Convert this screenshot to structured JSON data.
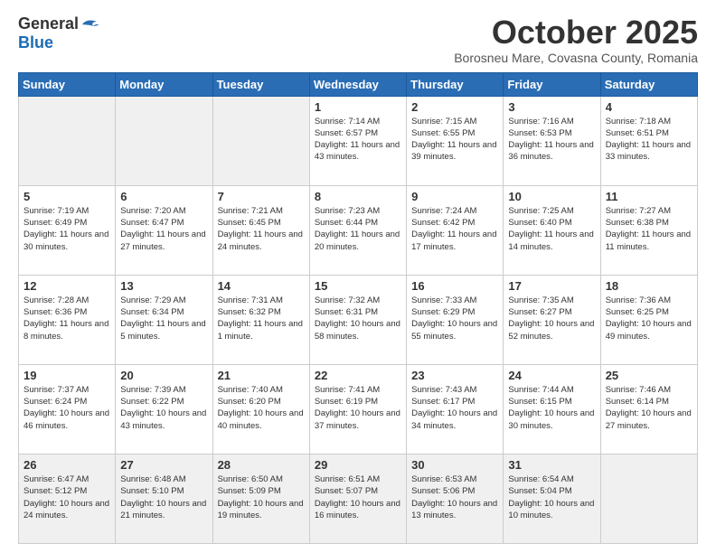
{
  "logo": {
    "general": "General",
    "blue": "Blue"
  },
  "title": "October 2025",
  "subtitle": "Borosneu Mare, Covasna County, Romania",
  "days_of_week": [
    "Sunday",
    "Monday",
    "Tuesday",
    "Wednesday",
    "Thursday",
    "Friday",
    "Saturday"
  ],
  "weeks": [
    [
      {
        "day": "",
        "info": "",
        "empty": true
      },
      {
        "day": "",
        "info": "",
        "empty": true
      },
      {
        "day": "",
        "info": "",
        "empty": true
      },
      {
        "day": "1",
        "info": "Sunrise: 7:14 AM\nSunset: 6:57 PM\nDaylight: 11 hours and 43 minutes."
      },
      {
        "day": "2",
        "info": "Sunrise: 7:15 AM\nSunset: 6:55 PM\nDaylight: 11 hours and 39 minutes."
      },
      {
        "day": "3",
        "info": "Sunrise: 7:16 AM\nSunset: 6:53 PM\nDaylight: 11 hours and 36 minutes."
      },
      {
        "day": "4",
        "info": "Sunrise: 7:18 AM\nSunset: 6:51 PM\nDaylight: 11 hours and 33 minutes."
      }
    ],
    [
      {
        "day": "5",
        "info": "Sunrise: 7:19 AM\nSunset: 6:49 PM\nDaylight: 11 hours and 30 minutes."
      },
      {
        "day": "6",
        "info": "Sunrise: 7:20 AM\nSunset: 6:47 PM\nDaylight: 11 hours and 27 minutes."
      },
      {
        "day": "7",
        "info": "Sunrise: 7:21 AM\nSunset: 6:45 PM\nDaylight: 11 hours and 24 minutes."
      },
      {
        "day": "8",
        "info": "Sunrise: 7:23 AM\nSunset: 6:44 PM\nDaylight: 11 hours and 20 minutes."
      },
      {
        "day": "9",
        "info": "Sunrise: 7:24 AM\nSunset: 6:42 PM\nDaylight: 11 hours and 17 minutes."
      },
      {
        "day": "10",
        "info": "Sunrise: 7:25 AM\nSunset: 6:40 PM\nDaylight: 11 hours and 14 minutes."
      },
      {
        "day": "11",
        "info": "Sunrise: 7:27 AM\nSunset: 6:38 PM\nDaylight: 11 hours and 11 minutes."
      }
    ],
    [
      {
        "day": "12",
        "info": "Sunrise: 7:28 AM\nSunset: 6:36 PM\nDaylight: 11 hours and 8 minutes."
      },
      {
        "day": "13",
        "info": "Sunrise: 7:29 AM\nSunset: 6:34 PM\nDaylight: 11 hours and 5 minutes."
      },
      {
        "day": "14",
        "info": "Sunrise: 7:31 AM\nSunset: 6:32 PM\nDaylight: 11 hours and 1 minute."
      },
      {
        "day": "15",
        "info": "Sunrise: 7:32 AM\nSunset: 6:31 PM\nDaylight: 10 hours and 58 minutes."
      },
      {
        "day": "16",
        "info": "Sunrise: 7:33 AM\nSunset: 6:29 PM\nDaylight: 10 hours and 55 minutes."
      },
      {
        "day": "17",
        "info": "Sunrise: 7:35 AM\nSunset: 6:27 PM\nDaylight: 10 hours and 52 minutes."
      },
      {
        "day": "18",
        "info": "Sunrise: 7:36 AM\nSunset: 6:25 PM\nDaylight: 10 hours and 49 minutes."
      }
    ],
    [
      {
        "day": "19",
        "info": "Sunrise: 7:37 AM\nSunset: 6:24 PM\nDaylight: 10 hours and 46 minutes."
      },
      {
        "day": "20",
        "info": "Sunrise: 7:39 AM\nSunset: 6:22 PM\nDaylight: 10 hours and 43 minutes."
      },
      {
        "day": "21",
        "info": "Sunrise: 7:40 AM\nSunset: 6:20 PM\nDaylight: 10 hours and 40 minutes."
      },
      {
        "day": "22",
        "info": "Sunrise: 7:41 AM\nSunset: 6:19 PM\nDaylight: 10 hours and 37 minutes."
      },
      {
        "day": "23",
        "info": "Sunrise: 7:43 AM\nSunset: 6:17 PM\nDaylight: 10 hours and 34 minutes."
      },
      {
        "day": "24",
        "info": "Sunrise: 7:44 AM\nSunset: 6:15 PM\nDaylight: 10 hours and 30 minutes."
      },
      {
        "day": "25",
        "info": "Sunrise: 7:46 AM\nSunset: 6:14 PM\nDaylight: 10 hours and 27 minutes."
      }
    ],
    [
      {
        "day": "26",
        "info": "Sunrise: 6:47 AM\nSunset: 5:12 PM\nDaylight: 10 hours and 24 minutes.",
        "last": true
      },
      {
        "day": "27",
        "info": "Sunrise: 6:48 AM\nSunset: 5:10 PM\nDaylight: 10 hours and 21 minutes.",
        "last": true
      },
      {
        "day": "28",
        "info": "Sunrise: 6:50 AM\nSunset: 5:09 PM\nDaylight: 10 hours and 19 minutes.",
        "last": true
      },
      {
        "day": "29",
        "info": "Sunrise: 6:51 AM\nSunset: 5:07 PM\nDaylight: 10 hours and 16 minutes.",
        "last": true
      },
      {
        "day": "30",
        "info": "Sunrise: 6:53 AM\nSunset: 5:06 PM\nDaylight: 10 hours and 13 minutes.",
        "last": true
      },
      {
        "day": "31",
        "info": "Sunrise: 6:54 AM\nSunset: 5:04 PM\nDaylight: 10 hours and 10 minutes.",
        "last": true
      },
      {
        "day": "",
        "info": "",
        "empty": true,
        "last": true
      }
    ]
  ]
}
